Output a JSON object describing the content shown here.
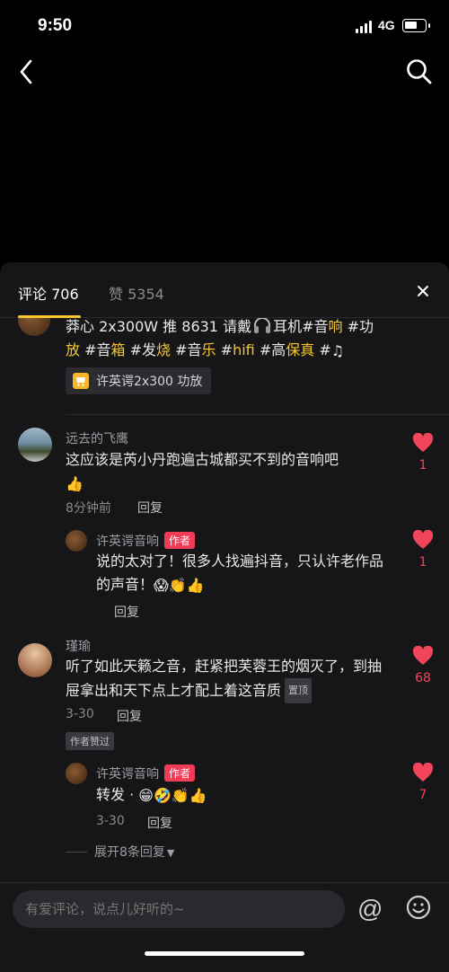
{
  "status": {
    "time": "9:50",
    "network": "4G"
  },
  "sheet": {
    "tab_comments": "评论 706",
    "tab_likes": "赞 5354"
  },
  "post": {
    "line1_a": "莽心 2x300W 推 8631 请戴",
    "line1_b": "耳机#音",
    "line1_c": "响",
    "line1_d": " #功",
    "line2_a": "放",
    "line2_b": " #音",
    "line2_c": "箱",
    "line2_d": " #发",
    "line2_e": "烧",
    "line2_f": " #音",
    "line2_g": "乐",
    "line2_h": " #",
    "line2_i": "hifi",
    "line2_j": " #高",
    "line2_k": "保真",
    "line2_l": " #",
    "product": "许英谔2x300 功放"
  },
  "comments": [
    {
      "name": "远去的飞鹰",
      "text": "这应该是芮小丹跑遍古城都买不到的音响吧",
      "time": "8分钟前",
      "reply": "回复",
      "likes": "1"
    },
    {
      "name": "许英谔音响",
      "badge": "作者",
      "text": "说的太对了！很多人找遍抖音，只认许老作品的声音！",
      "reply": "回复",
      "likes": "1"
    },
    {
      "name": "瑾瑜",
      "text": "听了如此天籁之音，赶紧把芙蓉王的烟灭了，到抽屉拿出和天下点上才配上着这音质",
      "pin": "置顶",
      "time": "3-30",
      "reply": "回复",
      "liked_by_author": "作者赞过",
      "likes": "68"
    },
    {
      "name": "许英谔音响",
      "badge": "作者",
      "text": "转发 ·",
      "time": "3-30",
      "reply": "回复",
      "likes": "7"
    }
  ],
  "expand": "展开8条回复",
  "input": {
    "placeholder": "有爱评论，说点儿好听的~"
  },
  "colors": {
    "accent": "#f7c62f",
    "like": "#f2445a",
    "author_badge": "#f13b57"
  }
}
